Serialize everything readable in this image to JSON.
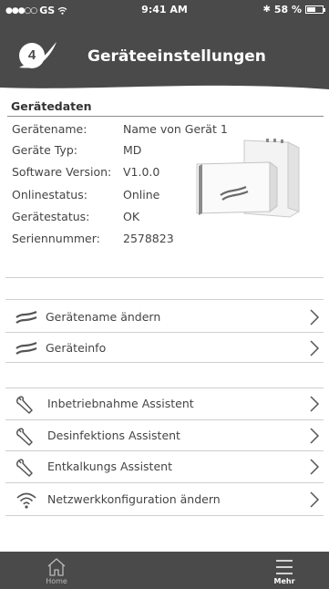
{
  "status_bar": {
    "carrier": "GS",
    "time": "9:41 AM",
    "battery": "58 %",
    "battery_level": 0.58,
    "signal_icon": "signal-dots-icon",
    "wifi_icon": "wifi-icon",
    "bluetooth_icon": "bluetooth-icon"
  },
  "header": {
    "logo_number": "4",
    "title": "Geräteeinstellungen"
  },
  "device_data": {
    "section_title": "Gerätedaten",
    "rows": [
      {
        "label": "Gerätename:",
        "value": "Name von Gerät 1"
      },
      {
        "label": "Geräte Typ:",
        "value": "MD"
      },
      {
        "label": "Software Version:",
        "value": "V1.0.0"
      },
      {
        "label": "Onlinestatus:",
        "value": "Online"
      },
      {
        "label": "Gerätestatus:",
        "value": "OK"
      },
      {
        "label": "Seriennummer:",
        "value": "2578823"
      }
    ]
  },
  "menu_group_1": [
    {
      "label": "Gerätename ändern",
      "icon": "device-wave-icon"
    },
    {
      "label": "Geräteinfo",
      "icon": "device-wave-icon"
    }
  ],
  "menu_group_2": [
    {
      "label": "Inbetriebnahme Assistent",
      "icon": "wrench-icon"
    },
    {
      "label": "Desinfektions Assistent",
      "icon": "wrench-icon"
    },
    {
      "label": "Entkalkungs Assistent",
      "icon": "wrench-icon"
    },
    {
      "label": "Netzwerkkonfiguration ändern",
      "icon": "wifi-icon"
    }
  ],
  "tab_bar": {
    "home_label": "Home",
    "home_icon": "home-icon",
    "more_label": "Mehr",
    "more_icon": "menu-icon"
  },
  "colors": {
    "header_bg": "#4a4a4a",
    "text": "#444444",
    "divider": "#cfcfcf"
  }
}
